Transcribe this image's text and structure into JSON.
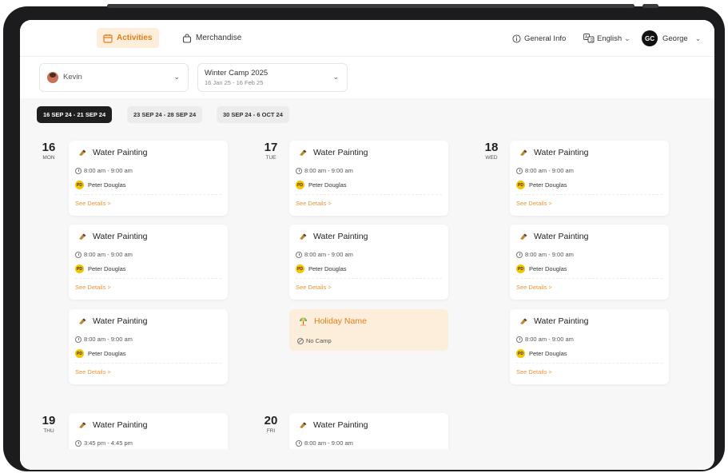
{
  "nav": {
    "tabs": [
      {
        "label": "Activities",
        "icon": "calendar-icon",
        "active": true
      },
      {
        "label": "Merchandise",
        "icon": "bag-icon",
        "active": false
      }
    ],
    "general_info": "General Info",
    "language": "English",
    "user": {
      "initials": "GC",
      "name": "George"
    }
  },
  "filters": {
    "child": "Kevin",
    "camp": {
      "title": "Winter Camp 2025",
      "dates": "16 Jan 25 - 16 Feb 25"
    }
  },
  "weeks": [
    {
      "label": "16 SEP 24 - 21 SEP 24",
      "active": true
    },
    {
      "label": "23 SEP 24 - 28 SEP 24",
      "active": false
    },
    {
      "label": "30 SEP 24 - 6 OCT 24",
      "active": false
    }
  ],
  "days": [
    {
      "num": "16",
      "dow": "MON"
    },
    {
      "num": "17",
      "dow": "TUE"
    },
    {
      "num": "18",
      "dow": "WED"
    },
    {
      "num": "19",
      "dow": "THU"
    },
    {
      "num": "20",
      "dow": "FRI"
    }
  ],
  "activity": {
    "title": "Water Painting",
    "time": "8:00 am - 9:00 am",
    "time_thu": "3:45 pm - 4:45 pm",
    "instructor": "Peter Douglas",
    "instructor_initials": "PD",
    "details": "See Details >"
  },
  "holiday": {
    "title": "Holiday Name",
    "note": "No Camp"
  },
  "colors": {
    "accent": "#e37d17",
    "accent_bg": "#fdeedc",
    "badge": "#f6c400"
  }
}
